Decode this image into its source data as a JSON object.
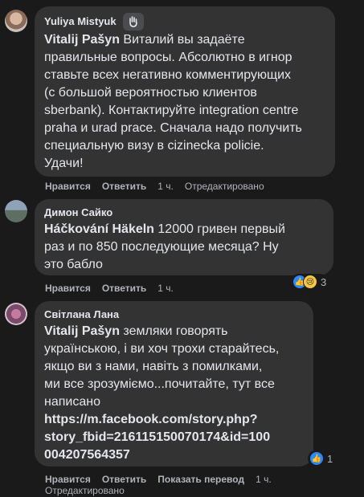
{
  "comments": [
    {
      "author": "Yuliya Mistyuk",
      "badge_icon": "wave-icon",
      "mention": "Vitalij Pašyn",
      "lines": [
        " Виталий вы задаёте",
        "правильные вопросы. Абсолютно в игнор",
        "ставьте всех негативно комментирующих",
        "(с большой вероятностью клиентов",
        "sberbank). Контактируйте integration centre",
        "praha и urad prace. Сначала надо получить",
        "специальную визу в cizinecka policie.",
        "Удачи!"
      ],
      "actions": {
        "like": "Нравится",
        "reply": "Ответить",
        "time": "1 ч.",
        "edited": "Отредактировано"
      }
    },
    {
      "author": "Димон Сайко",
      "mention": "Háčkování Häkeln",
      "lines": [
        " 12000 гривен первый",
        "раз и по 850 последующие месяца? Ну",
        "это бабло"
      ],
      "actions": {
        "like": "Нравится",
        "reply": "Ответить",
        "time": "1 ч."
      },
      "reactions": {
        "icons": [
          "like-icon",
          "sad-icon"
        ],
        "count": "3"
      }
    },
    {
      "author": "Світлана Лана",
      "mention": "Vitalij Pašyn",
      "lines": [
        " земляки говорять",
        "українською, і ви хоч трохи старайтесь,",
        "якщо ви з нами, навіть з помилками,",
        "ми все зрозуміємо...почитайте, тут все",
        "написано"
      ],
      "link_lines": [
        "https://m.facebook.com/story.php?",
        "story_fbid=216115150070174&id=100",
        "004207564357"
      ],
      "actions": {
        "like": "Нравится",
        "reply": "Ответить",
        "translate": "Показать перевод",
        "time": "1 ч.",
        "edited": "Отредактировано"
      },
      "reactions": {
        "icons": [
          "like-icon"
        ],
        "count": "1"
      }
    }
  ]
}
